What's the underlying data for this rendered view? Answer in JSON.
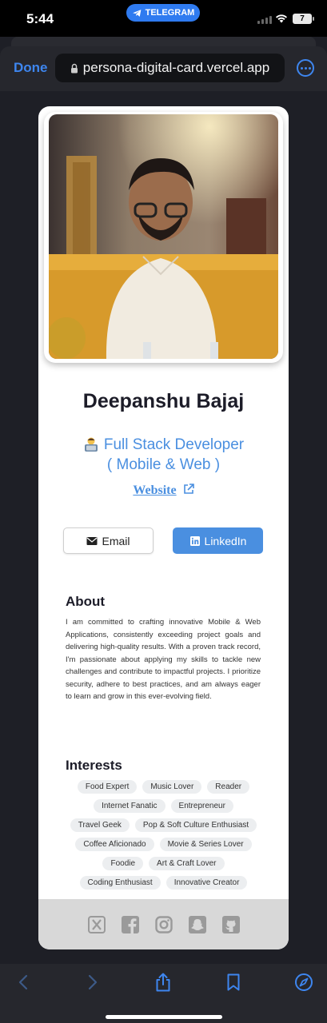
{
  "status_bar": {
    "time": "5:44",
    "telegram_label": "TELEGRAM",
    "battery": "7"
  },
  "browser": {
    "done_label": "Done",
    "url": "persona-digital-card.vercel.app"
  },
  "profile": {
    "name": "Deepanshu Bajaj",
    "role_line1": "Full Stack Developer",
    "role_line2": "( Mobile & Web )",
    "website_label": "Website"
  },
  "buttons": {
    "email_label": "Email",
    "linkedin_label": "LinkedIn"
  },
  "about": {
    "heading": "About",
    "text": "I am committed to crafting innovative Mobile & Web Applications, consistently exceeding project goals and delivering high-quality results. With a proven track record, I'm passionate about applying my skills to tackle new challenges and contribute to impactful projects. I prioritize security, adhere to best practices, and am always eager to learn and grow in this ever-evolving field."
  },
  "interests": {
    "heading": "Interests",
    "items": [
      "Food Expert",
      "Music Lover",
      "Reader",
      "Internet Fanatic",
      "Entrepreneur",
      "Travel Geek",
      "Pop & Soft Culture Enthusiast",
      "Coffee Aficionado",
      "Movie & Series Lover",
      "Foodie",
      "Art & Craft Lover",
      "Coding Enthusiast",
      "Innovative Creator"
    ]
  },
  "social_icons": [
    "x-icon",
    "facebook-icon",
    "instagram-icon",
    "snapchat-icon",
    "github-icon"
  ],
  "toolbar_icons": [
    "back-arrow-icon",
    "forward-arrow-icon",
    "share-icon",
    "bookmarks-icon",
    "compass-icon"
  ],
  "colors": {
    "accent_blue": "#4a8fe0",
    "browser_blue": "#3e86ef",
    "page_bg": "#1e1f26"
  }
}
